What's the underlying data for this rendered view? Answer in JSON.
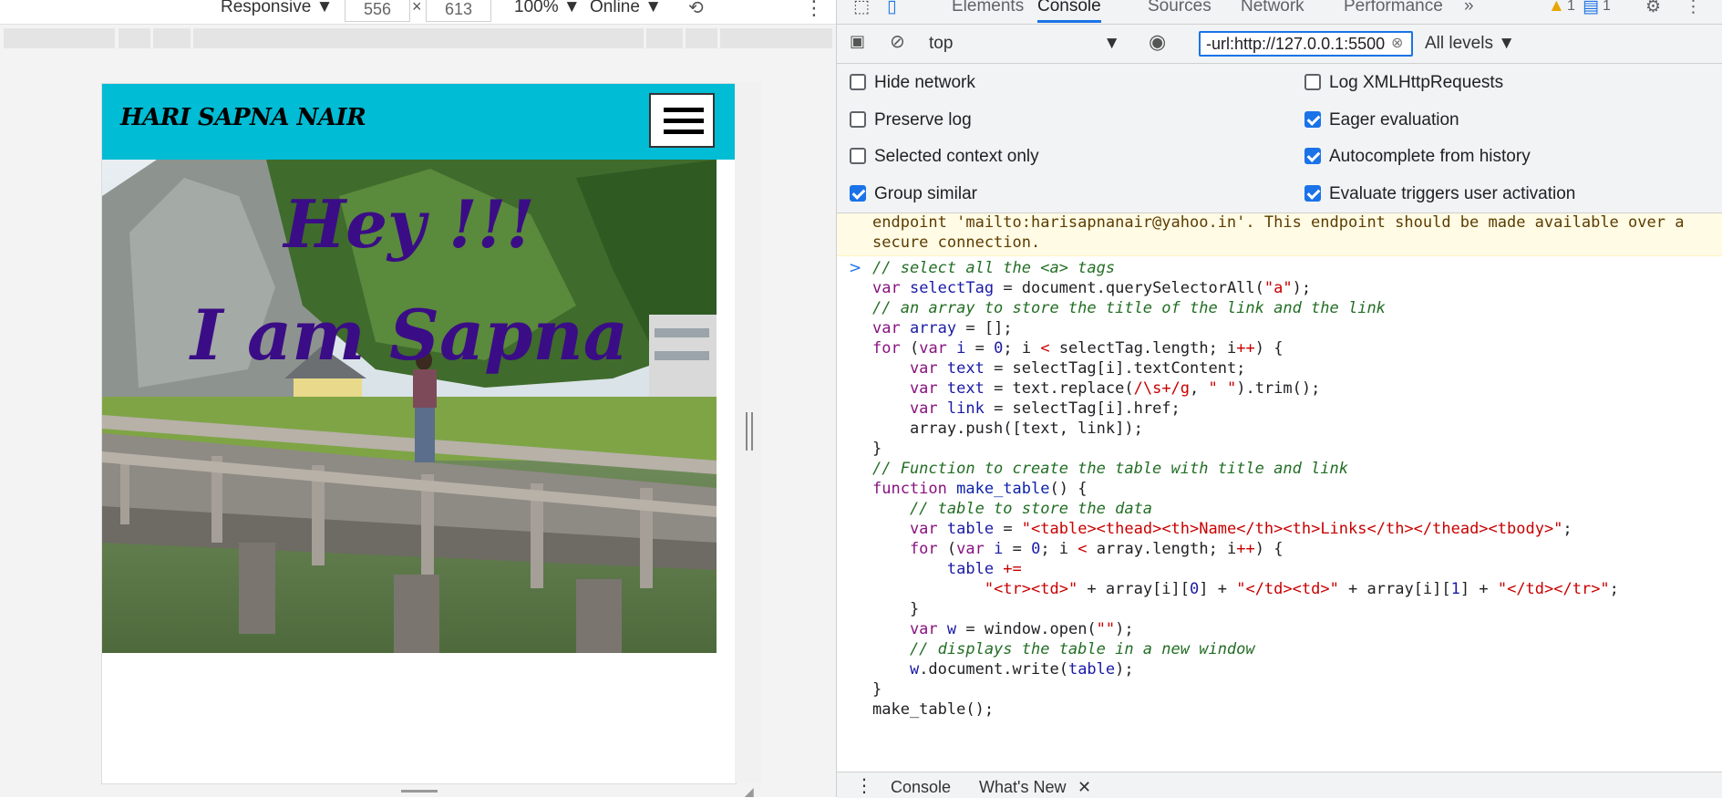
{
  "device_toolbar": {
    "device": "Responsive",
    "width": "556",
    "height": "613",
    "zoom": "100%",
    "network": "Online",
    "times": "×"
  },
  "site": {
    "title": "HARI SAPNA NAIR",
    "hero_line1": "Hey !!!",
    "hero_line2": "I am Sapna"
  },
  "devtools": {
    "tabs": [
      "Elements",
      "Console",
      "Sources",
      "Network",
      "Performance"
    ],
    "active_tab": "Console",
    "more": "»",
    "warnings": "1",
    "messages": "1",
    "context": "top",
    "filter": "-url:http://127.0.0.1:5500",
    "levels": "All levels",
    "settings": [
      {
        "label": "Hide network",
        "checked": false
      },
      {
        "label": "Log XMLHttpRequests",
        "checked": false
      },
      {
        "label": "Preserve log",
        "checked": false
      },
      {
        "label": "Eager evaluation",
        "checked": true
      },
      {
        "label": "Selected context only",
        "checked": false
      },
      {
        "label": "Autocomplete from history",
        "checked": true
      },
      {
        "label": "Group similar",
        "checked": true
      },
      {
        "label": "Evaluate triggers user activation",
        "checked": true
      }
    ],
    "warning_lines": [
      "endpoint 'mailto:harisapnanair@yahoo.in'. This endpoint should be made available over a",
      "secure connection."
    ],
    "drawer_tabs": [
      "Console",
      "What's New"
    ]
  },
  "code": {
    "l01": "// select all the <a> tags",
    "l02a": "var",
    "l02b": " selectTag",
    "l02c": " = document.querySelectorAll(",
    "l02d": "\"a\"",
    "l02e": ");",
    "l03": "// an array to store the title of the link and the link",
    "l04a": "var",
    "l04b": " array",
    "l04c": " = [];",
    "l05a": "for",
    "l05b": " (",
    "l05c": "var",
    "l05d": " i",
    "l05e": " = ",
    "l05f": "0",
    "l05g": "; i ",
    "l05h": "<",
    "l05i": " selectTag.length; i",
    "l05j": "++",
    "l05k": ") {",
    "l06a": "    var",
    "l06b": " text",
    "l06c": " = selectTag[i].textContent;",
    "l07a": "    var",
    "l07b": " text",
    "l07c": " = text.replace(",
    "l07d": "/\\s+/g",
    "l07e": ", ",
    "l07f": "\" \"",
    "l07g": ").trim();",
    "l08a": "    var",
    "l08b": " link",
    "l08c": " = selectTag[i].href;",
    "l09": "    array.push([text, link]);",
    "l10": "}",
    "l11": "// Function to create the table with title and link",
    "l12a": "function",
    "l12b": " make_table",
    "l12c": "() {",
    "l13": "    // table to store the data",
    "l14a": "    var",
    "l14b": " table",
    "l14c": " = ",
    "l14d": "\"<table><thead><th>Name</th><th>Links</th></thead><tbody>\"",
    "l14e": ";",
    "l15a": "    for",
    "l15b": " (",
    "l15c": "var",
    "l15d": " i",
    "l15e": " = ",
    "l15f": "0",
    "l15g": "; i ",
    "l15h": "<",
    "l15i": " array.length; i",
    "l15j": "++",
    "l15k": ") {",
    "l16a": "        table",
    "l16b": " +=",
    "l17a": "            ",
    "l17b": "\"<tr><td>\"",
    "l17c": " + array[i][",
    "l17d": "0",
    "l17e": "] + ",
    "l17f": "\"</td><td>\"",
    "l17g": " + array[i][",
    "l17h": "1",
    "l17i": "] + ",
    "l17j": "\"</td></tr>\"",
    "l17k": ";",
    "l18": "    }",
    "l19a": "    var",
    "l19b": " w",
    "l19c": " = window.open(",
    "l19d": "\"\"",
    "l19e": ");",
    "l20": "    // displays the table in a new window",
    "l21a": "    w",
    "l21b": ".document.write(",
    "l21c": "table",
    "l21d": ");",
    "l22": "}",
    "l23": "make_table();"
  }
}
